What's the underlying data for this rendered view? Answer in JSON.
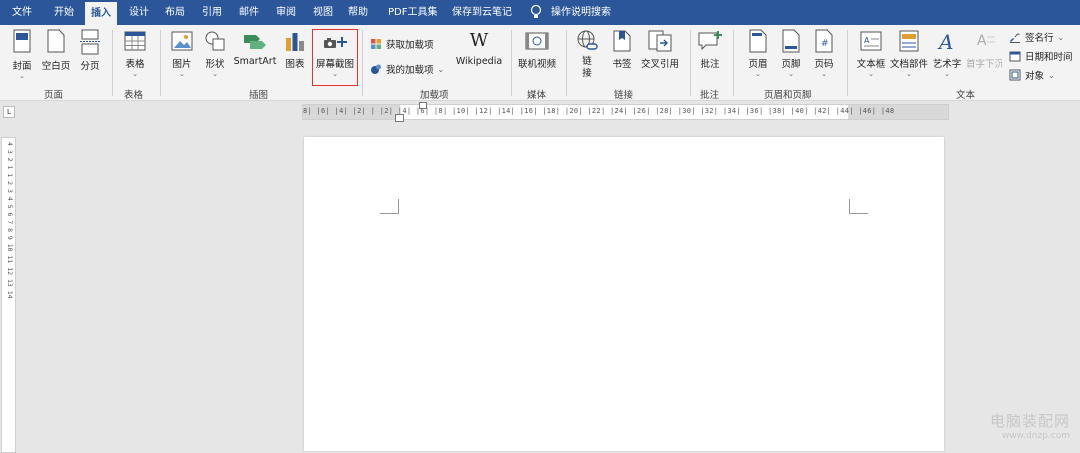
{
  "tabs": {
    "file": "文件",
    "home": "开始",
    "insert": "插入",
    "design": "设计",
    "layout": "布局",
    "references": "引用",
    "mailings": "邮件",
    "review": "审阅",
    "view": "视图",
    "help": "帮助",
    "pdf": "PDF工具集",
    "cloud": "保存到云笔记",
    "tellme": "操作说明搜索"
  },
  "ribbon": {
    "pages": {
      "cover": "封面",
      "blank": "空白页",
      "break": "分页",
      "group": "页面"
    },
    "tables": {
      "table": "表格",
      "group": "表格"
    },
    "illustrations": {
      "picture": "图片",
      "shapes": "形状",
      "smartart": "SmartArt",
      "chart": "图表",
      "screenshot": "屏幕截图",
      "group": "插图"
    },
    "addins": {
      "get": "获取加载项",
      "my": "我的加载项",
      "wikipedia": "Wikipedia",
      "wiki_glyph": "W",
      "group": "加载项"
    },
    "media": {
      "video": "联机视频",
      "group": "媒体"
    },
    "links": {
      "link": "链接",
      "bookmark": "书签",
      "crossref": "交叉引用",
      "group": "链接"
    },
    "comments": {
      "comment": "批注",
      "group": "批注"
    },
    "headerfooter": {
      "header": "页眉",
      "footer": "页脚",
      "pagenum": "页码",
      "group": "页眉和页脚"
    },
    "text": {
      "textbox": "文本框",
      "quickparts": "文档部件",
      "wordart": "艺术字",
      "dropcap": "首字下沉",
      "signature": "签名行",
      "datetime": "日期和时间",
      "object": "对象",
      "group": "文本"
    }
  },
  "ruler": {
    "h_ticks": "8| |6| |4| |2| |  |2| |4| |6| |8| |10| |12| |14| |16| |18| |20| |22| |24| |26| |28| |30| |32| |34| |36| |38| |40| |42| |44| |46| |48",
    "v_ticks": "4 3 2 1 1 2 3 4 5 6 7 8 9 10 11 12 13 14",
    "corner": "L"
  },
  "watermark": {
    "line1": "电脑装配网",
    "line2": "www.dnzp.com"
  },
  "colors": {
    "accent": "#2b579a",
    "highlight": "#e03333"
  }
}
